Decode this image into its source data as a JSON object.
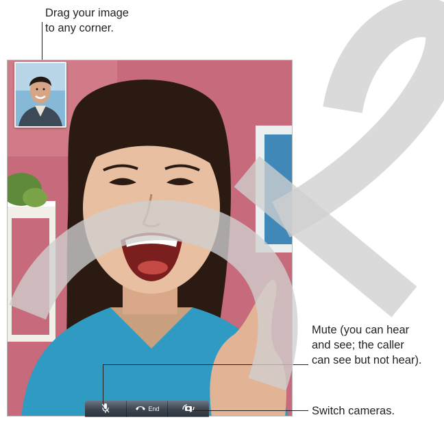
{
  "callouts": {
    "drag_pip": "Drag your image\nto any corner.",
    "mute": "Mute (you can hear\nand see; the caller\ncan see but not hear).",
    "switch_cameras": "Switch cameras."
  },
  "call_controls": {
    "mute_icon": "microphone-slash-icon",
    "end_label": "End",
    "end_icon": "phone-hang-up-icon",
    "switch_icon": "camera-rotate-icon"
  },
  "colors": {
    "wall": "#c9687a",
    "shirt": "#2e9ac0",
    "toolbar": "#3e4752",
    "watermark": "#cccccc"
  }
}
